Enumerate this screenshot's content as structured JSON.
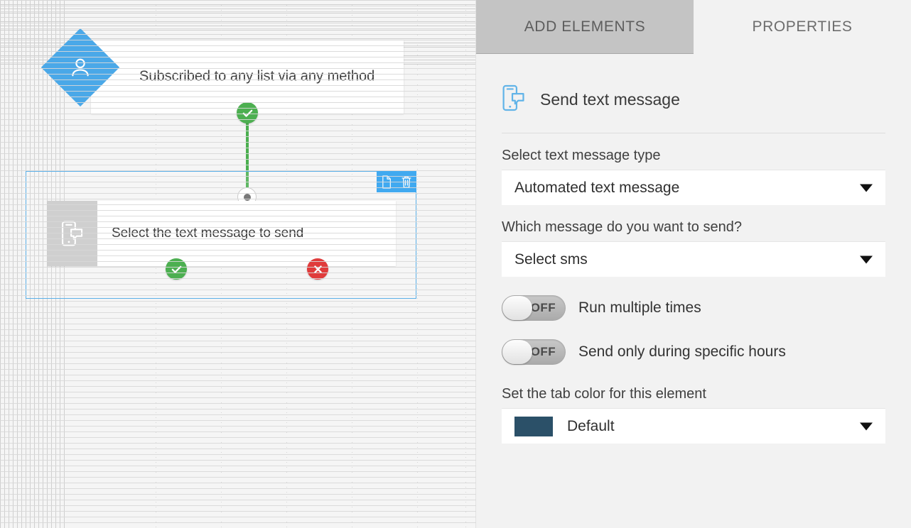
{
  "canvas": {
    "trigger_node": {
      "title": "Subscribed to any list via any method",
      "icon": "person-icon",
      "icon_color": "#4aa8e8",
      "out_badge": "check-icon"
    },
    "action_node": {
      "title": "Select the text message to send",
      "icon": "sms-phone-icon",
      "selected": true,
      "yes_badge": "check-icon",
      "no_badge": "cross-icon",
      "toolbar": {
        "duplicate": "document-copy-icon",
        "delete": "trash-icon"
      }
    },
    "connector": {
      "line_color": "#4CAF50",
      "dot": "connector-dot"
    }
  },
  "panel": {
    "tabs": [
      {
        "label": "ADD ELEMENTS",
        "active": true
      },
      {
        "label": "PROPERTIES",
        "active": false
      }
    ],
    "header": {
      "title": "Send text message",
      "icon": "sms-phone-icon",
      "icon_color": "#62b4e8"
    },
    "fields": {
      "message_type_label": "Select text message type",
      "message_type_value": "Automated text message",
      "which_message_label": "Which message do you want to send?",
      "which_message_value": "Select sms",
      "tab_color_label": "Set the tab color for this element",
      "tab_color_value": "Default",
      "tab_color_swatch": "#2b5068"
    },
    "toggles": [
      {
        "state": "OFF",
        "label": "Run multiple times"
      },
      {
        "state": "OFF",
        "label": "Send only during specific hours"
      }
    ]
  }
}
